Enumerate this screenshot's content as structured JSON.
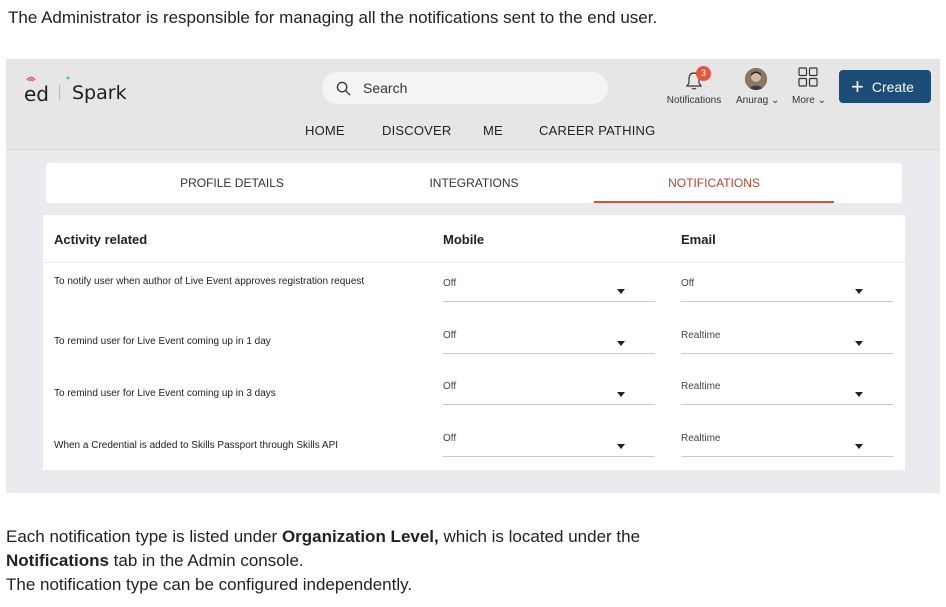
{
  "doc": {
    "intro": "The Administrator is responsible for managing all the notifications sent to the end user.",
    "outro_line1_pre": "Each notification type is listed under ",
    "outro_line1_bold": "Organization Level,",
    "outro_line1_post": " which is located under the",
    "outro_line2_bold": "Notifications",
    "outro_line2_post": " tab in the Admin console.",
    "outro_line3": "The notification type can be configured independently."
  },
  "app": {
    "logo_ed": "ed",
    "logo_spark": "Spark",
    "search_placeholder": "Search",
    "nav": [
      "HOME",
      "DISCOVER",
      "ME",
      "CAREER PATHING"
    ],
    "notifications_label": "Notifications",
    "notifications_count": "3",
    "user_label": "Anurag",
    "more_label": "More",
    "create_label": "Create",
    "accent_color": "#1c4d78",
    "badge_color": "#e6553a"
  },
  "tabs": [
    "PROFILE DETAILS",
    "INTEGRATIONS",
    "NOTIFICATIONS"
  ],
  "active_tab": "NOTIFICATIONS",
  "table": {
    "headers": [
      "Activity related",
      "Mobile",
      "Email"
    ],
    "rows": [
      {
        "activity": "To notify user when author of Live Event approves registration request",
        "mobile": "Off",
        "email": "Off"
      },
      {
        "activity": "To remind user for Live Event coming up in 1 day",
        "mobile": "Off",
        "email": "Realtime"
      },
      {
        "activity": "To remind user for Live Event coming up in 3 days",
        "mobile": "Off",
        "email": "Realtime"
      },
      {
        "activity": "When a Credential is added to Skills Passport through Skills API",
        "mobile": "Off",
        "email": "Realtime"
      }
    ]
  }
}
